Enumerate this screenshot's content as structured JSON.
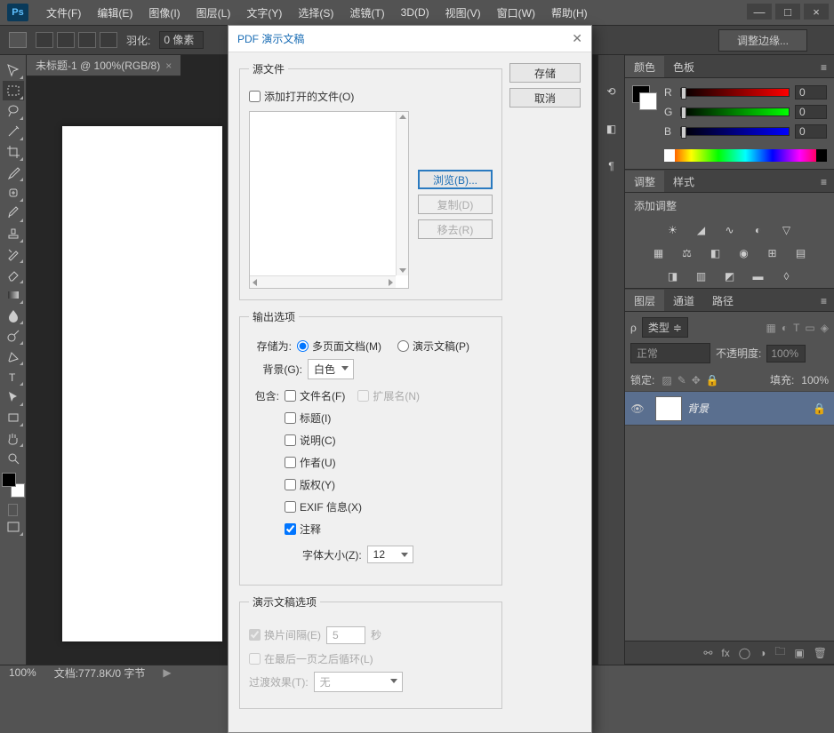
{
  "app": {
    "logo": "Ps"
  },
  "menu": [
    "文件(F)",
    "编辑(E)",
    "图像(I)",
    "图层(L)",
    "文字(Y)",
    "选择(S)",
    "滤镜(T)",
    "3D(D)",
    "视图(V)",
    "窗口(W)",
    "帮助(H)"
  ],
  "winControls": {
    "min": "—",
    "max": "□",
    "close": "×"
  },
  "optbar": {
    "feather_label": "羽化:",
    "feather_value": "0 像素",
    "refine": "调整边缘..."
  },
  "docTab": "未标题-1 @ 100%(RGB/8)",
  "status": {
    "zoom": "100%",
    "doc": "文档:777.8K/0 字节"
  },
  "colorPanel": {
    "tabs": [
      "颜色",
      "色板"
    ],
    "labels": {
      "r": "R",
      "g": "G",
      "b": "B"
    },
    "values": {
      "r": "0",
      "g": "0",
      "b": "0"
    }
  },
  "adjustPanel": {
    "tabs": [
      "调整",
      "样式"
    ],
    "title": "添加调整"
  },
  "layersPanel": {
    "tabs": [
      "图层",
      "通道",
      "路径"
    ],
    "kind": "类型",
    "blend": "正常",
    "opacity_label": "不透明度:",
    "opacity": "100%",
    "lock_label": "锁定:",
    "fill_label": "填充:",
    "fill": "100%",
    "layer": {
      "name": "背景"
    }
  },
  "dialog": {
    "title": "PDF 演示文稿",
    "save": "存储",
    "cancel": "取消",
    "source": {
      "legend": "源文件",
      "add_open": "添加打开的文件(O)",
      "browse": "浏览(B)...",
      "duplicate": "复制(D)",
      "remove": "移去(R)"
    },
    "output": {
      "legend": "输出选项",
      "save_as": "存储为:",
      "multi": "多页面文档(M)",
      "presentation": "演示文稿(P)",
      "bg_label": "背景(G):",
      "bg_value": "白色",
      "include": "包含:",
      "filename": "文件名(F)",
      "extension": "扩展名(N)",
      "title": "标题(I)",
      "description": "说明(C)",
      "author": "作者(U)",
      "copyright": "版权(Y)",
      "exif": "EXIF 信息(X)",
      "notes": "注释",
      "fontsize_label": "字体大小(Z):",
      "fontsize": "12"
    },
    "pres": {
      "legend": "演示文稿选项",
      "interval_label": "换片间隔(E)",
      "interval": "5",
      "seconds": "秒",
      "loop": "在最后一页之后循环(L)",
      "transition_label": "过渡效果(T):",
      "transition": "无"
    }
  }
}
